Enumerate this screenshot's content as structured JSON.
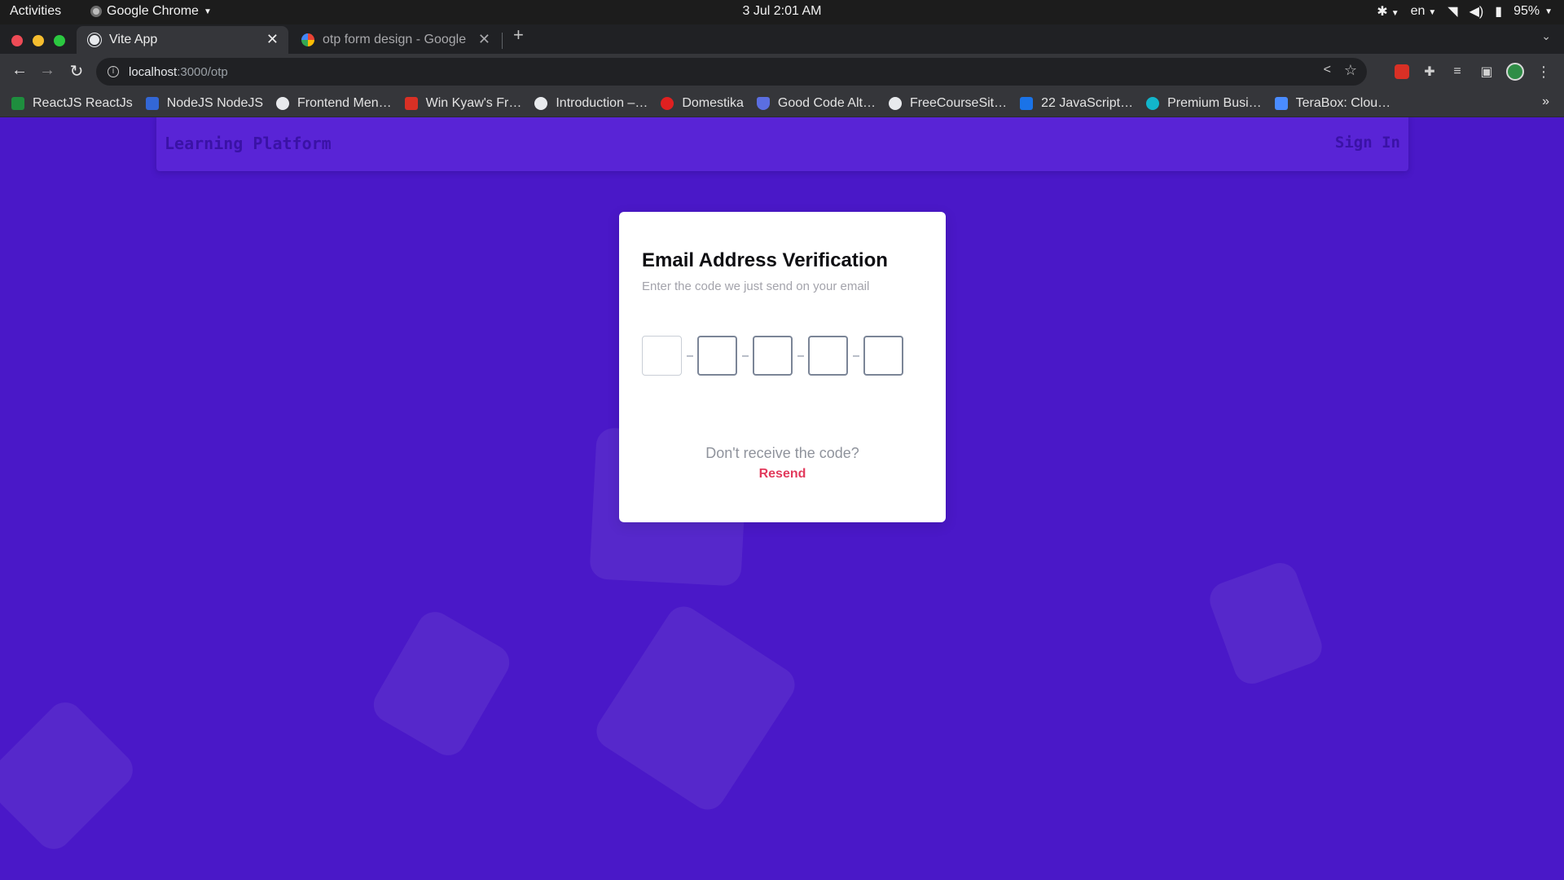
{
  "os_bar": {
    "activities": "Activities",
    "app_name": "Google Chrome",
    "clock": "3 Jul  2:01 AM",
    "language": "en",
    "battery": "95%"
  },
  "tabs": [
    {
      "title": "Vite App",
      "active": true
    },
    {
      "title": "otp form design - Google",
      "active": false
    }
  ],
  "omnibox": {
    "host": "localhost",
    "path": ":3000/otp"
  },
  "bookmarks": [
    {
      "label": "ReactJS ReactJs",
      "icon": "green-person-icon",
      "color": "#1e8e3e"
    },
    {
      "label": "NodeJS NodeJS",
      "icon": "blue-person-icon",
      "color": "#3367d6"
    },
    {
      "label": "Frontend Men…",
      "icon": "circle-icon",
      "color": "#e8eaed"
    },
    {
      "label": "Win Kyaw's Fr…",
      "icon": "red-m-icon",
      "color": "#d93025"
    },
    {
      "label": "Introduction –…",
      "icon": "globe-icon",
      "color": "#e8eaed"
    },
    {
      "label": "Domestika",
      "icon": "domestika-icon",
      "color": "#e02020"
    },
    {
      "label": "Good Code Alt…",
      "icon": "shield-icon",
      "color": "#5b6ee1"
    },
    {
      "label": "FreeCourseSit…",
      "icon": "wordpress-icon",
      "color": "#e8eaed"
    },
    {
      "label": "22 JavaScript…",
      "icon": "m-icon",
      "color": "#1a73e8"
    },
    {
      "label": "Premium Busi…",
      "icon": "search-bubble-icon",
      "color": "#12b5cb"
    },
    {
      "label": "TeraBox: Clou…",
      "icon": "terabox-icon",
      "color": "#4a8cff"
    }
  ],
  "site_nav": {
    "brand": "Learning Platform",
    "sign_in": "Sign In"
  },
  "otp_card": {
    "title": "Email Address Verification",
    "subtitle": "Enter the code we just send on your email",
    "digits": [
      "",
      "",
      "",
      "",
      ""
    ],
    "resend_question": "Don't receive the code?",
    "resend_label": "Resend"
  },
  "colors": {
    "page_background": "#4a18c8",
    "resend_accent": "#e23a5c"
  }
}
